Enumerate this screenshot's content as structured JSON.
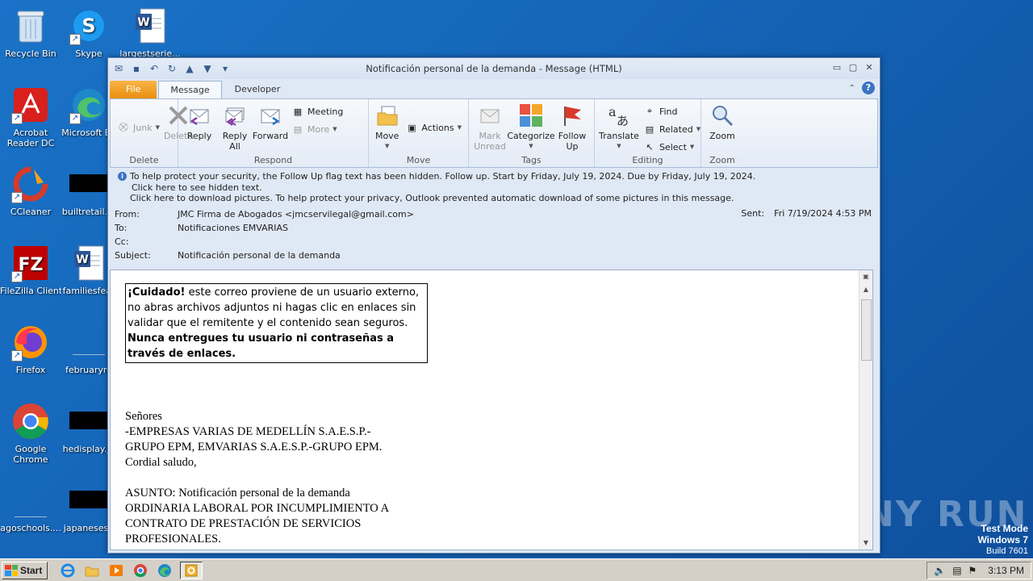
{
  "desktop": {
    "icons": [
      {
        "label": "Recycle Bin"
      },
      {
        "label": "Skype"
      },
      {
        "label": "largestserie..."
      },
      {
        "label": "Acrobat Reader DC"
      },
      {
        "label": "Microsoft Ed"
      },
      {
        "label": "CCleaner"
      },
      {
        "label": "builtretail.jp"
      },
      {
        "label": "FileZilla Client"
      },
      {
        "label": "familiesfeat"
      },
      {
        "label": "Firefox"
      },
      {
        "label": "februaryre"
      },
      {
        "label": "Google Chrome"
      },
      {
        "label": "hedisplay.jp"
      },
      {
        "label": "agoschools...."
      },
      {
        "label": "japanesesu"
      }
    ],
    "watermark": "ANY RUN",
    "test_mode": {
      "line1": "Test Mode",
      "line2": "Windows 7",
      "line3": "Build 7601"
    }
  },
  "window": {
    "title": "Notificación personal de la demanda  -  Message (HTML)",
    "tabs": [
      "File",
      "Message",
      "Developer"
    ],
    "ribbon": {
      "delete": {
        "group": "Delete",
        "junk": "Junk",
        "delete": "Delete"
      },
      "respond": {
        "group": "Respond",
        "reply": "Reply",
        "reply_all_1": "Reply",
        "reply_all_2": "All",
        "forward": "Forward",
        "meeting": "Meeting",
        "more": "More"
      },
      "move": {
        "group": "Move",
        "move": "Move",
        "actions": "Actions"
      },
      "tags": {
        "group": "Tags",
        "mark_unread_1": "Mark",
        "mark_unread_2": "Unread",
        "categorize": "Categorize",
        "follow_up_1": "Follow",
        "follow_up_2": "Up"
      },
      "editing": {
        "group": "Editing",
        "translate": "Translate",
        "find": "Find",
        "related": "Related",
        "select": "Select"
      },
      "zoom": {
        "group": "Zoom",
        "zoom": "Zoom"
      }
    },
    "infobar": {
      "line1": "To help protect your security, the Follow Up flag text has been hidden. Follow up.  Start by Friday, July 19, 2024.  Due by Friday, July 19, 2024.",
      "line2": "Click here to see hidden text.",
      "line3": "Click here to download pictures. To help protect your privacy, Outlook prevented automatic download of some pictures in this message."
    },
    "headers": {
      "from_label": "From:",
      "from_value": "JMC Firma de Abogados <jmcservilegal@gmail.com>",
      "to_label": "To:",
      "to_value": "Notificaciones EMVARIAS",
      "cc_label": "Cc:",
      "cc_value": "",
      "subject_label": "Subject:",
      "subject_value": "Notificación personal de la demanda",
      "sent_label": "Sent:",
      "sent_value": "Fri 7/19/2024 4:53 PM"
    },
    "body": {
      "warn_bold": "¡Cuidado!",
      "warn_text": " este correo proviene de un usuario externo, no abras archivos adjuntos ni hagas clic en enlaces sin validar que el remitente y el contenido sean seguros.",
      "warn_bold2": "Nunca entregues tu usuario ni contraseñas a través de enlaces.",
      "p1": "Señores",
      "p2": "-EMPRESAS VARIAS DE MEDELLÍN S.A.E.S.P.-",
      "p3": "GRUPO EPM, EMVARIAS S.A.E.S.P.-GRUPO EPM.",
      "p4": "Cordial saludo,",
      "p5": "ASUNTO: Notificación personal de la demanda",
      "p6": "ORDINARIA LABORAL POR INCUMPLIMIENTO A",
      "p7": "CONTRATO DE PRESTACIÓN DE SERVICIOS",
      "p8": "PROFESIONALES."
    }
  },
  "taskbar": {
    "start": "Start",
    "clock": "3:13 PM"
  }
}
